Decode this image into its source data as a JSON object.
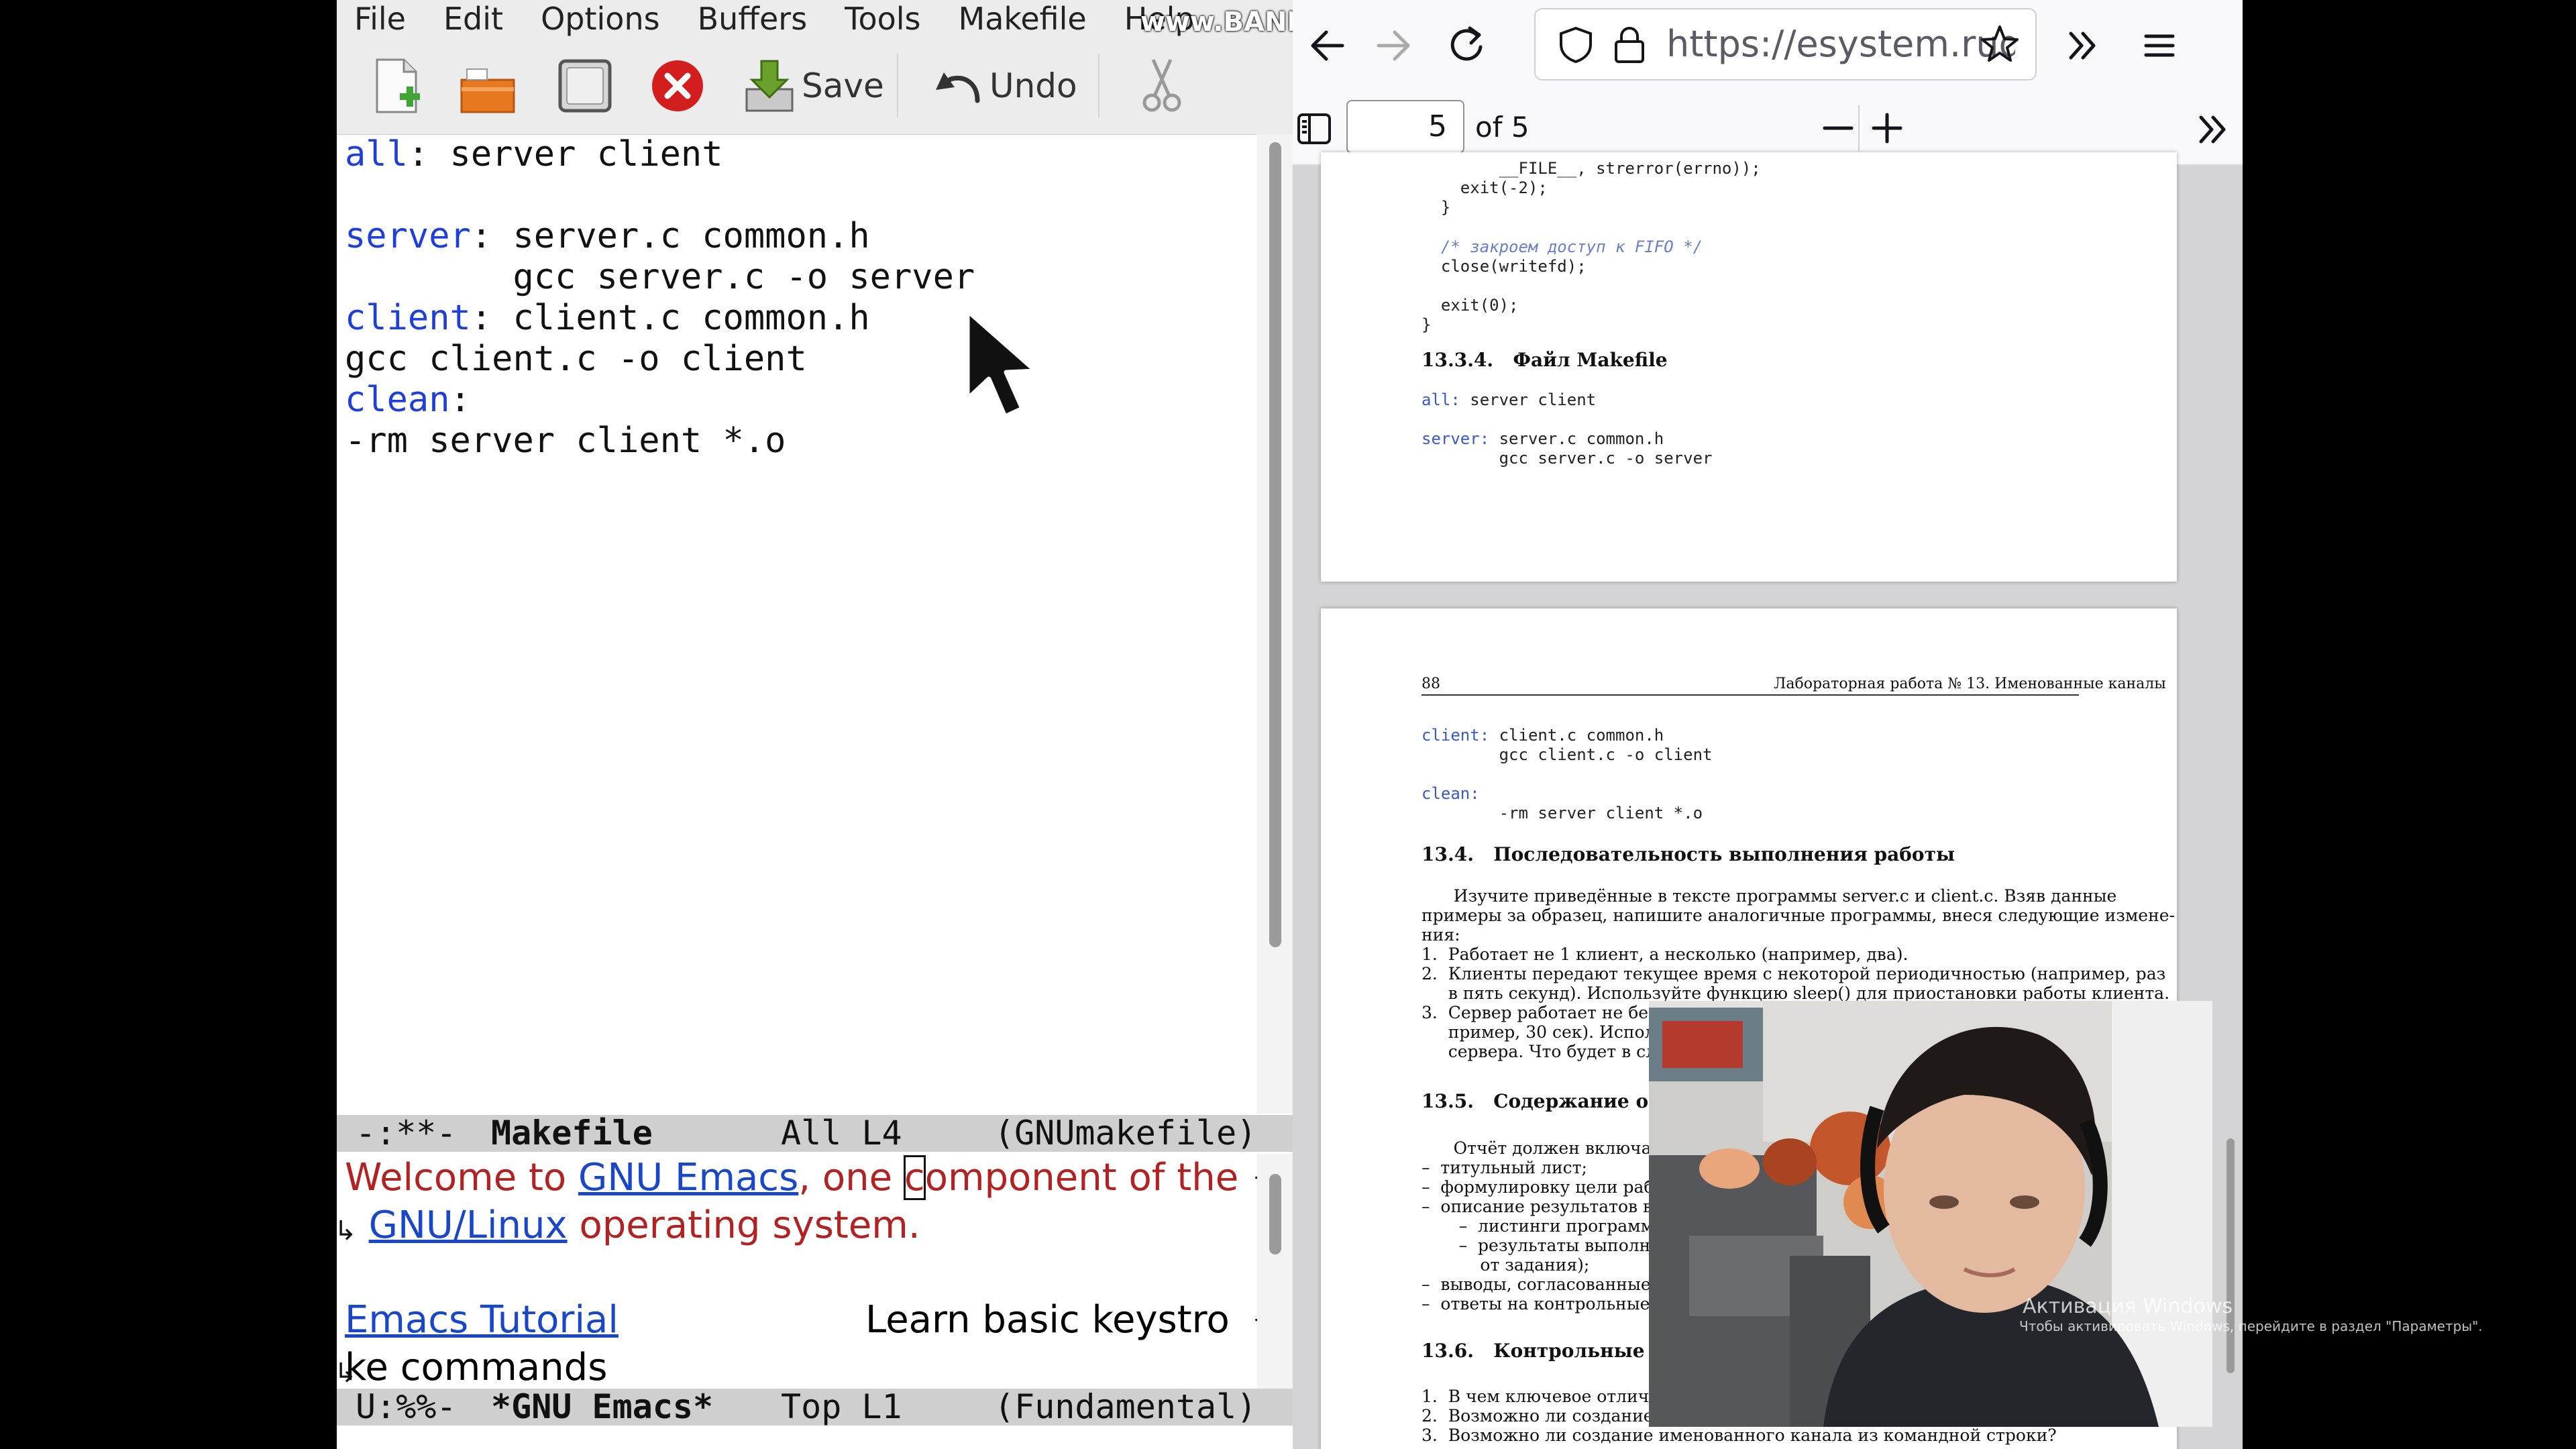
{
  "emacs": {
    "menu": [
      "File",
      "Edit",
      "Options",
      "Buffers",
      "Tools",
      "Makefile",
      "Help"
    ],
    "toolbar": {
      "save_label": "Save",
      "undo_label": "Undo"
    },
    "editor_lines": [
      {
        "kw": "all",
        "rest": ": server client"
      },
      {
        "kw": "",
        "rest": ""
      },
      {
        "kw": "server",
        "rest": ": server.c common.h"
      },
      {
        "kw": "",
        "rest": "        gcc server.c -o server"
      },
      {
        "kw": "client",
        "rest": ": client.c common.h"
      },
      {
        "kw": "",
        "rest": "gcc client.c -o client"
      },
      {
        "kw": "clean",
        "rest": ":"
      },
      {
        "kw": "",
        "rest": "-rm server client *.o"
      }
    ],
    "modeline_top": {
      "state": "-:**-",
      "buffer": "Makefile",
      "position": "All L4",
      "mode": "(GNUmakefile)"
    },
    "splash": {
      "welcome_prefix": "Welcome to ",
      "welcome_link": "GNU Emacs",
      "welcome_middle_1": ", one ",
      "welcome_cursor_char": "c",
      "welcome_middle_2": "omponent of the",
      "welcome_link2": "GNU/Linux",
      "welcome_suffix": " operating system.",
      "tutorial_link": "Emacs Tutorial",
      "tutorial_desc_1": "Learn basic keystro",
      "tutorial_desc_2": "ke commands"
    },
    "modeline_bottom": {
      "state": "U:%%-",
      "buffer": "*GNU Emacs*",
      "position": "Top L1",
      "mode": "(Fundamental)"
    }
  },
  "watermark": "www.BANDICAM.com",
  "firefox": {
    "url": "https://esystem.rudn.ru",
    "page_number": "5",
    "page_total": "of 5",
    "pdf": {
      "page1_code_top": [
        "        __FILE__, strerror(errno));",
        "    exit(-2);",
        "  }"
      ],
      "page1_comment": "  /* закроем доступ к FIFO */",
      "page1_code_mid": [
        "  close(writefd);",
        "",
        "  exit(0);",
        "}"
      ],
      "heading_makefile": "13.3.4.   Файл Makefile",
      "mk_all_kw": "all:",
      "mk_all_rest": " server client",
      "mk_server_kw": "server:",
      "mk_server_rest": " server.c common.h",
      "mk_server_cmd": "        gcc server.c -o server",
      "page2_number": "88",
      "page2_header": "Лабораторная работа № 13. Именованные каналы",
      "mk_client_kw": "client:",
      "mk_client_rest": " client.c common.h",
      "mk_client_cmd": "        gcc client.c -o client",
      "mk_clean_kw": "clean:",
      "mk_clean_cmd": "        -rm server client *.o",
      "heading_sequence": "13.4.   Последовательность выполнения работы",
      "para_1": "      Изучите приведённые в тексте программы server.c и client.c. Взяв данные",
      "para_2": "примеры за образец, напишите аналогичные программы, внеся следующие измене-",
      "para_3": "ния:",
      "item_1": "1.  Работает не 1 клиент, а несколько (например, два).",
      "item_2a": "2.  Клиенты передают текущее время с некоторой периодичностью (например, раз",
      "item_2b": "     в пять секунд). Используйте функцию sleep() для приостановки работы клиента.",
      "item_3a": "3.  Сервер работает не беско",
      "item_3b": "     пример, 30 сек). Использу",
      "item_3c": "     сервера. Что будет в случа",
      "heading_contents": "13.5.   Содержание отчё",
      "report_intro": "      Отчёт должен включать:",
      "report_items": [
        "–  титульный лист;",
        "–  формулировку цели работ",
        "–  описание результатов вып",
        "       –  листинги программ;",
        "       –  результаты выполнен",
        "           от задания);",
        "–  выводы, согласованные с",
        "–  ответы на контрольные во"
      ],
      "heading_questions": "13.6.   Контрольные воп",
      "q_items": [
        "1.  В чем ключевое отличие и",
        "2.  Возможно ли создание не",
        "3.  Возможно ли создание именованного канала из командной строки?"
      ]
    }
  },
  "activation": {
    "title": "Активация Windows",
    "subtitle": "Чтобы активировать Windows, перейдите в раздел \"Параметры\"."
  }
}
